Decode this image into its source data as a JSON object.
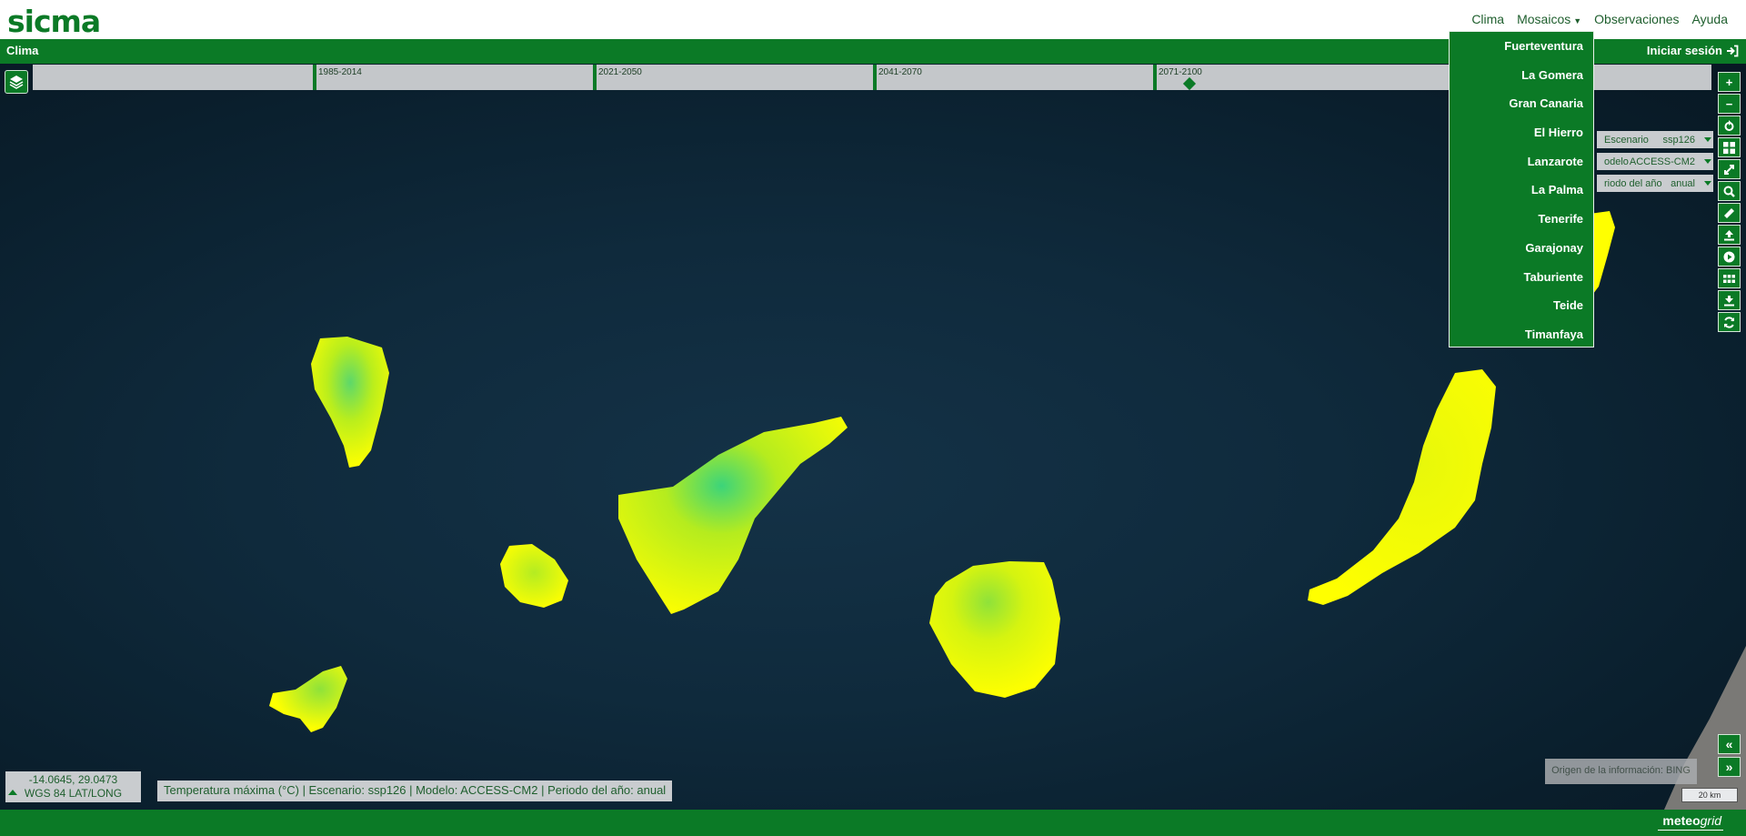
{
  "header": {
    "logo": "sicma",
    "nav": [
      {
        "label": "Clima"
      },
      {
        "label": "Mosaicos"
      },
      {
        "label": "Observaciones"
      },
      {
        "label": "Ayuda"
      }
    ]
  },
  "section": {
    "title": "Clima",
    "login_label": "Iniciar sesión"
  },
  "timeline": {
    "periods": [
      "1985-2014",
      "2021-2050",
      "2041-2070",
      "2071-2100"
    ]
  },
  "mosaicos_menu": {
    "items": [
      "Fuerteventura",
      "La Gomera",
      "Gran Canaria",
      "El Hierro",
      "Lanzarote",
      "La Palma",
      "Tenerife",
      "Garajonay",
      "Taburiente",
      "Teide",
      "Timanfaya"
    ]
  },
  "filters": {
    "escenario": {
      "label": "Escenario",
      "value": "ssp126"
    },
    "modelo": {
      "label": "odelo",
      "value": "ACCESS-CM2"
    },
    "periodo": {
      "label": "riodo del año",
      "value": "anual"
    }
  },
  "toolbar": {
    "zoom_in": "+",
    "zoom_out": "−",
    "prev": "«",
    "next": "»"
  },
  "coords": {
    "value": "-14.0645, 29.0473",
    "system": "WGS 84 LAT/LONG"
  },
  "legend": "Temperatura máxima (°C) | Escenario: ssp126 | Modelo: ACCESS-CM2 | Periodo del año: anual",
  "source": "Origen de la información: BING",
  "scale": "20 km",
  "footer": {
    "brand_a": "meteo",
    "brand_b": "grid"
  },
  "colors": {
    "brand_green": "#0b7a26",
    "sea": "#0f2a3c",
    "island_high": "#ffff00",
    "island_low": "#33cc66"
  }
}
